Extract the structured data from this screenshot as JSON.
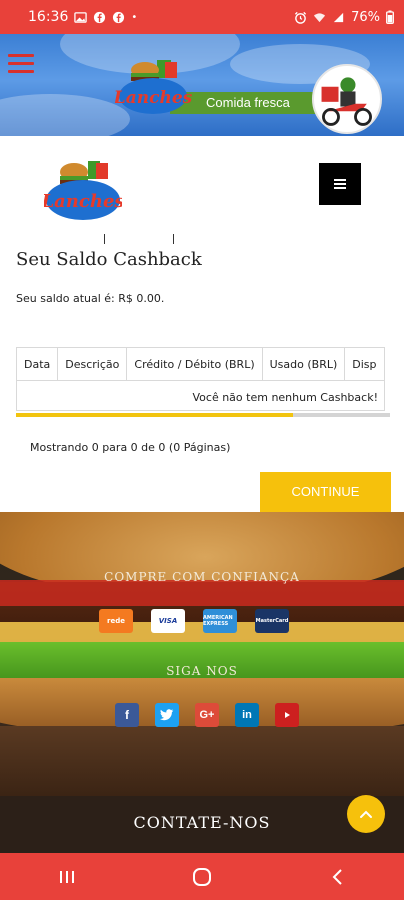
{
  "status_bar": {
    "time": "16:36",
    "battery": "76%"
  },
  "banner": {
    "slogan": "Comida fresca",
    "logo_text": "Lanches"
  },
  "header": {
    "logo_text": "Lanches"
  },
  "page": {
    "title": "Seu Saldo Cashback",
    "balance_text": "Seu saldo atual é: R$ 0.00."
  },
  "table": {
    "columns": [
      "Data",
      "Descrição",
      "Crédito / Débito (BRL)",
      "Usado (BRL)",
      "Disp"
    ],
    "empty_message": "Você não tem nenhum Cashback!",
    "scroll_fraction": 0.74
  },
  "pagination": {
    "text": "Mostrando 0 para 0 de 0 (0 Páginas)"
  },
  "buttons": {
    "continue": "CONTINUE"
  },
  "footer": {
    "trust_heading": "COMPRE COM CONFIANÇA",
    "follow_heading": "SIGA NOS",
    "contact_heading": "CONTATE-NOS",
    "payments": [
      "rede",
      "VISA",
      "AMERICAN EXPRESS",
      "MasterCard"
    ],
    "socials": [
      "facebook-icon",
      "twitter-icon",
      "google-plus-icon",
      "linkedin-icon",
      "youtube-icon"
    ]
  }
}
